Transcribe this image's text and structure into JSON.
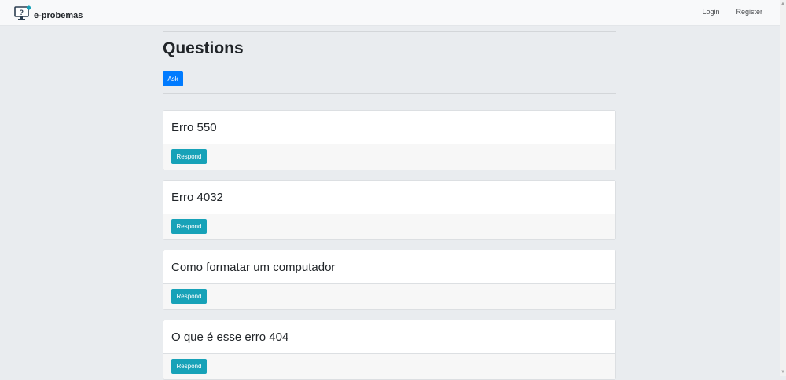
{
  "navbar": {
    "brand": "e-probemas",
    "links": [
      "Login",
      "Register"
    ]
  },
  "page": {
    "title": "Questions",
    "ask_label": "Ask"
  },
  "questions": [
    {
      "title": "Erro 550",
      "action": "Respond"
    },
    {
      "title": "Erro 4032",
      "action": "Respond"
    },
    {
      "title": "Como formatar um computador",
      "action": "Respond"
    },
    {
      "title": "O que é esse erro 404",
      "action": "Respond"
    }
  ],
  "colors": {
    "primary": "#007bff",
    "info": "#17a2b8",
    "background": "#e9ecef",
    "navbar": "#f8f9fa"
  }
}
